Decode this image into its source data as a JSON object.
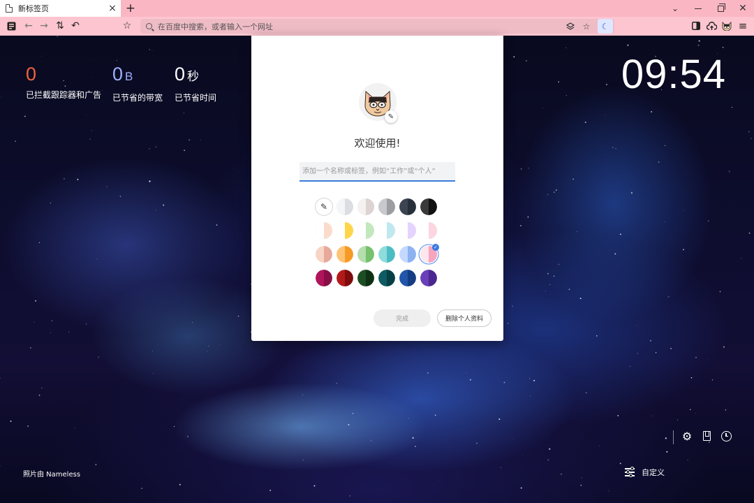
{
  "tab": {
    "title": "新标签页",
    "close": "×",
    "new_tab": "+"
  },
  "window": {
    "tabs_menu": "⌄",
    "close": "✕"
  },
  "toolbar": {
    "url_placeholder": "在百度中搜索，或者输入一个网址",
    "back": "←",
    "forward": "→",
    "sync": "⇅",
    "undo": "↶",
    "star": "☆",
    "moon": "☾",
    "menu": "≡"
  },
  "stats": {
    "trackers": {
      "value": "0",
      "label": "已拦截跟踪器和广告"
    },
    "bandwidth": {
      "value": "0",
      "unit": "B",
      "label": "已节省的带宽"
    },
    "time": {
      "value": "0",
      "unit": "秒",
      "label": "已节省时间"
    }
  },
  "clock": "09:54",
  "photo_credit": "照片由 Nameless",
  "bottom": {
    "customize_label": "自定义",
    "settings_glyph": "⚙"
  },
  "dialog": {
    "welcome": "欢迎使用!",
    "name_placeholder": "添加一个名称或标签，例如“工作”或“个人”",
    "done_label": "完成",
    "delete_label": "删除个人资料",
    "edit_glyph": "✎",
    "check_glyph": "✓",
    "picker_glyph": "✎",
    "selected_theme_index": 17,
    "themes": [
      {
        "name": "color-picker"
      },
      {
        "l": "#f4f5f8",
        "r": "#dcdde2"
      },
      {
        "l": "#f5f1f0",
        "r": "#dcd3d2"
      },
      {
        "l": "#c8c9cd",
        "r": "#9c9da3"
      },
      {
        "l": "#3b4450",
        "r": "#27303a"
      },
      {
        "l": "#3a3a3a",
        "r": "#111111"
      },
      {
        "l": "#ffffff",
        "r": "#fbdccb"
      },
      {
        "l": "#ffffff",
        "r": "#ffd54a"
      },
      {
        "l": "#ffffff",
        "r": "#c4e8bd"
      },
      {
        "l": "#ffffff",
        "r": "#bfe9ef"
      },
      {
        "l": "#ffffff",
        "r": "#e5d3ff"
      },
      {
        "l": "#ffffff",
        "r": "#fcd6e0"
      },
      {
        "l": "#f8d4c4",
        "r": "#e6a99a"
      },
      {
        "l": "#ffc375",
        "r": "#f59b25"
      },
      {
        "l": "#b5ddae",
        "r": "#76c06e"
      },
      {
        "l": "#8fdcda",
        "r": "#4cbcc4"
      },
      {
        "l": "#c4d9ff",
        "r": "#8cb2f2"
      },
      {
        "l": "#fde6ec",
        "r": "#f7a5be"
      },
      {
        "l": "#b0145a",
        "r": "#8a0e46"
      },
      {
        "l": "#b21a1a",
        "r": "#7f0c0c"
      },
      {
        "l": "#1d4d22",
        "r": "#0e3114"
      },
      {
        "l": "#0e5b62",
        "r": "#063f46"
      },
      {
        "l": "#2156a8",
        "r": "#143d82"
      },
      {
        "l": "#6a3fb8",
        "r": "#4b2790"
      }
    ]
  }
}
